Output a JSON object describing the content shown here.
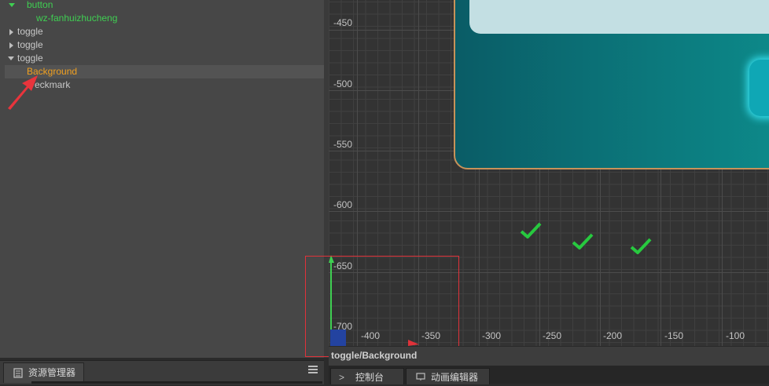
{
  "hierarchy": {
    "nodes": [
      {
        "label": "button",
        "color": "#3fcf52"
      },
      {
        "label": "wz-fanhuizhucheng",
        "color": "#3fcf52"
      },
      {
        "label": "toggle",
        "color": "#c8c8c8"
      },
      {
        "label": "toggle",
        "color": "#c8c8c8"
      },
      {
        "label": "toggle",
        "color": "#c8c8c8"
      },
      {
        "label": "Background",
        "color": "#f0a020"
      },
      {
        "label": "eckmark",
        "color": "#c8c8c8"
      }
    ]
  },
  "assets_panel": {
    "tab_label": "资源管理器"
  },
  "scene": {
    "y_ticks": [
      "-450",
      "-500",
      "-550",
      "-600",
      "-650",
      "-700"
    ],
    "x_ticks": [
      "-400",
      "-350",
      "-300",
      "-250",
      "-200",
      "-150",
      "-100"
    ]
  },
  "status_bar": {
    "path": "toggle/Background"
  },
  "bottom_tabs": [
    {
      "label": "控制台"
    },
    {
      "label": "动画编辑器"
    }
  ],
  "colors": {
    "selected_text": "#f0a020",
    "active_node": "#3fcf52",
    "annotation": "#e0323a",
    "checkmark": "#27c93f"
  }
}
